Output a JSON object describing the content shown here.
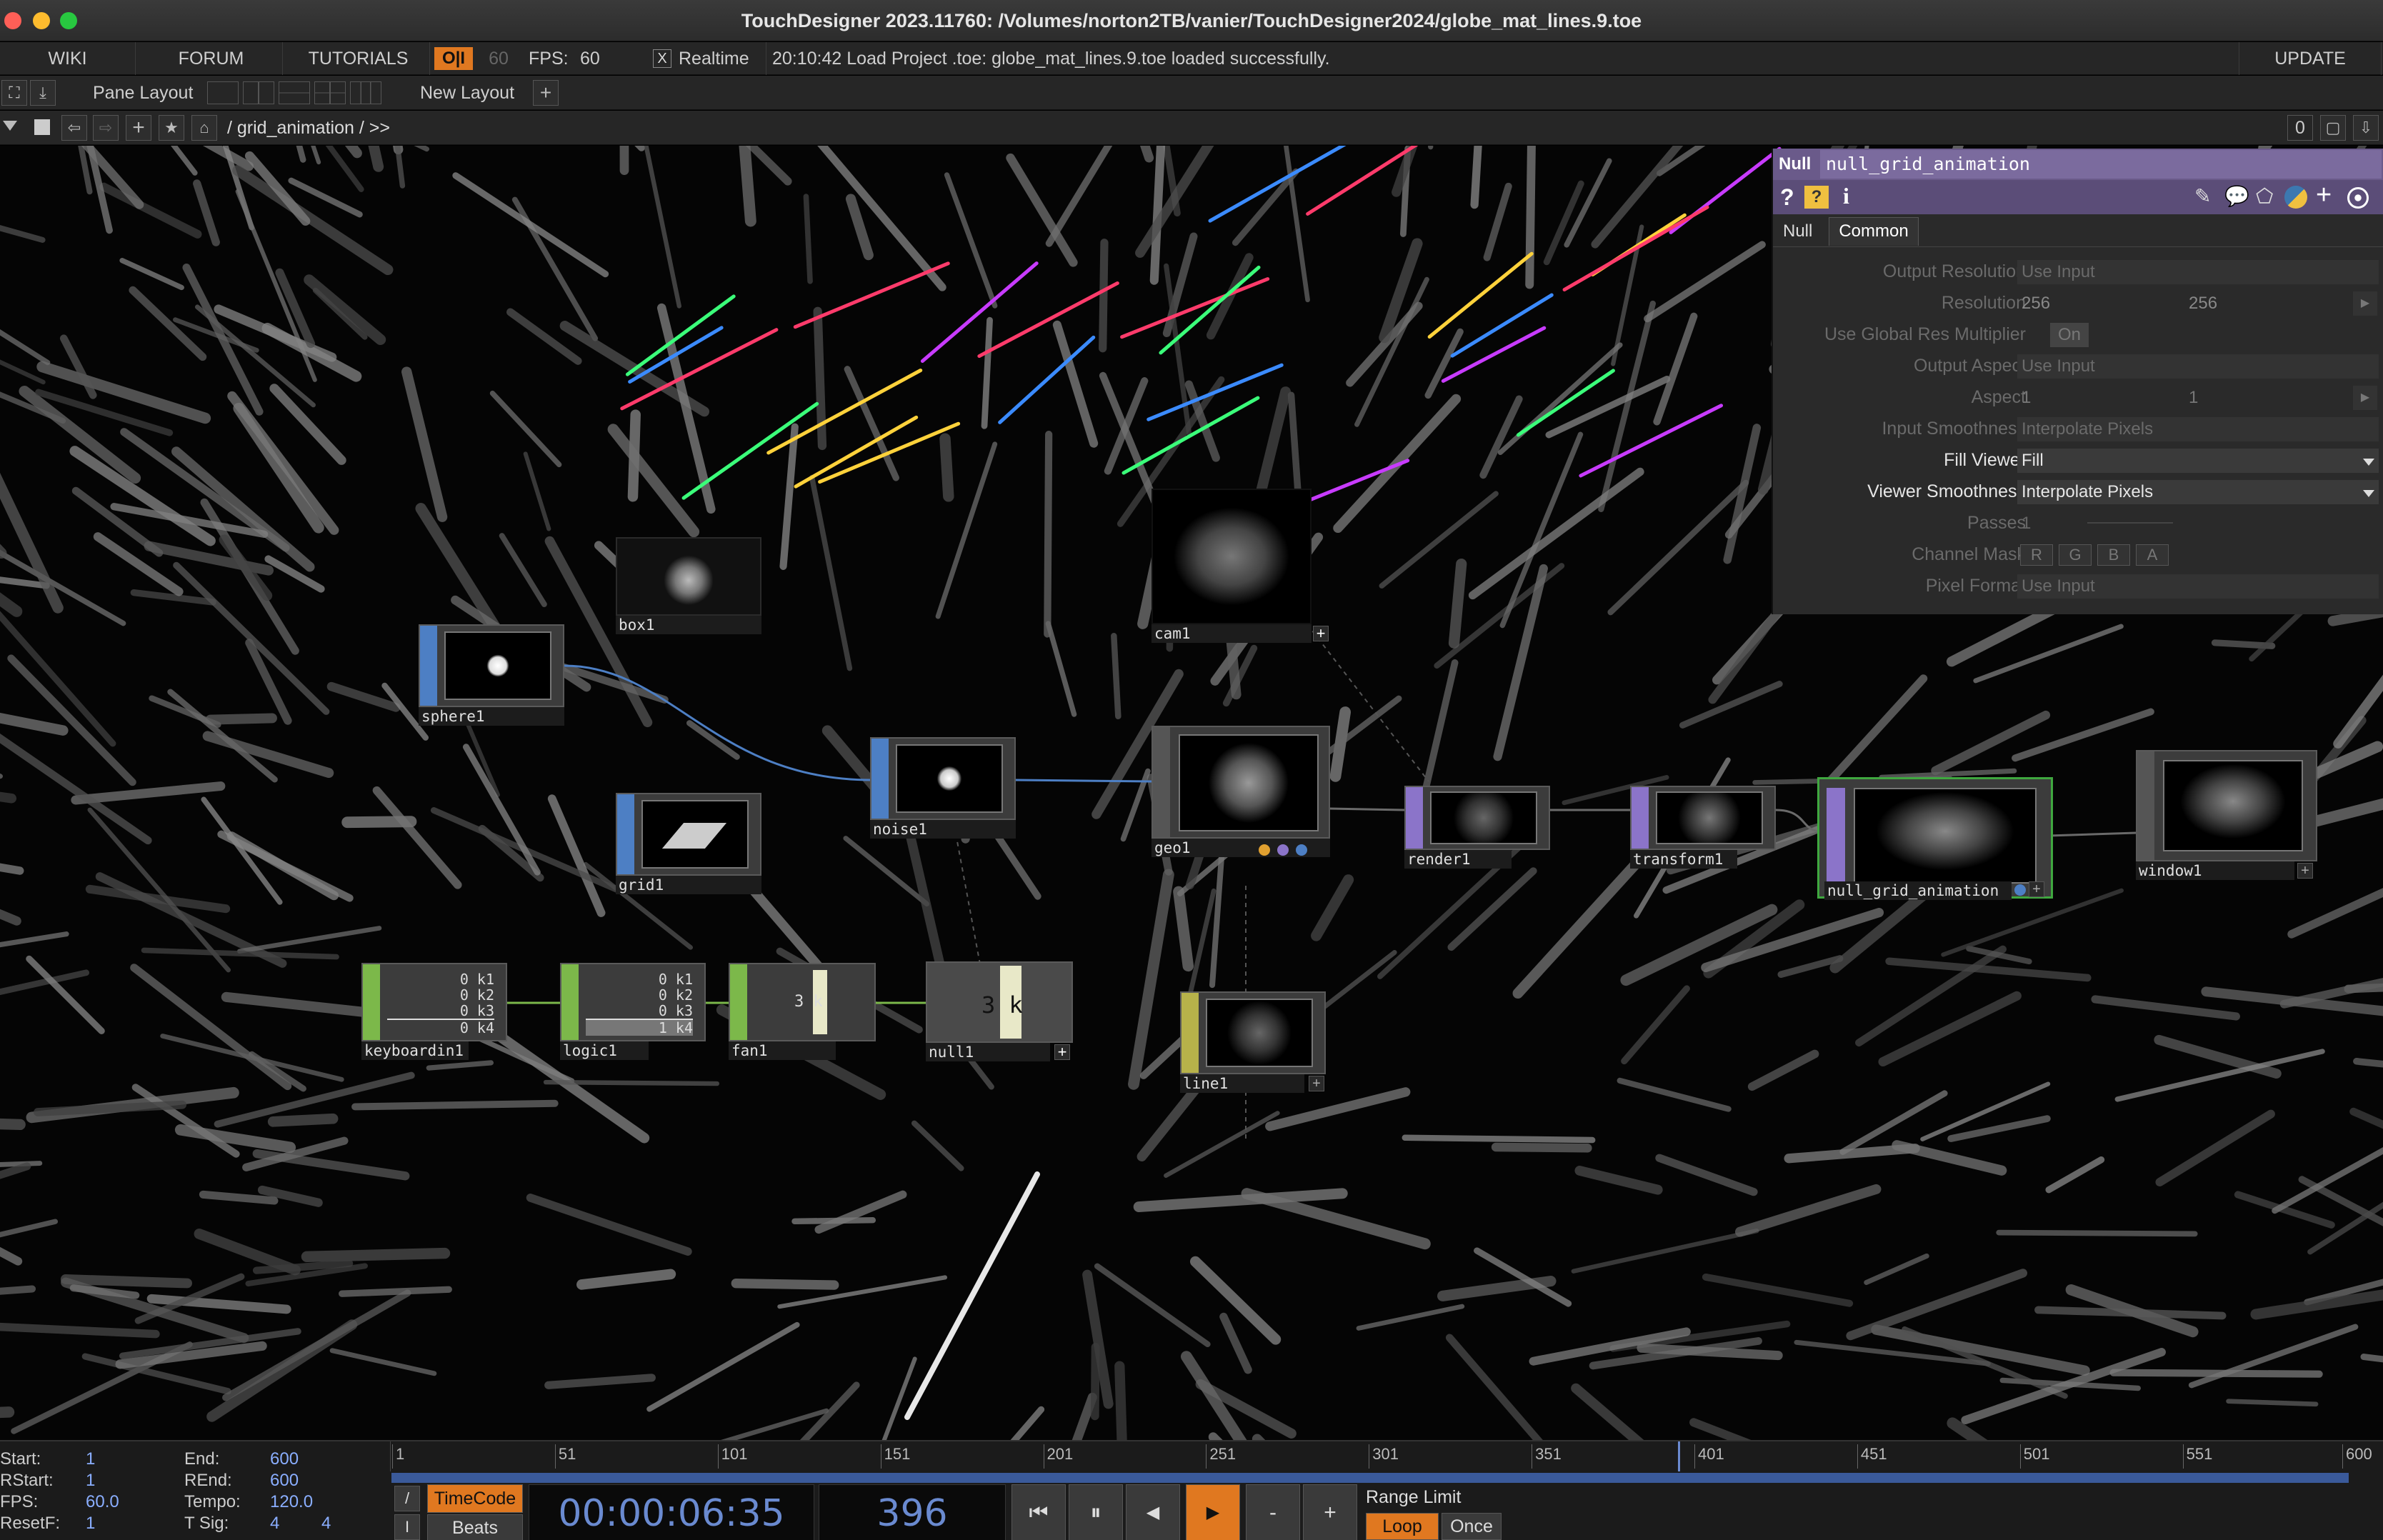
{
  "window": {
    "title": "TouchDesigner 2023.11760: /Volumes/norton2TB/vanier/TouchDesigner2024/globe_mat_lines.9.toe"
  },
  "menubar": {
    "wiki": "WIKI",
    "forum": "FORUM",
    "tutorials": "TUTORIALS",
    "oi": "O|I",
    "fps_cap": "60",
    "fps_label": "FPS:",
    "fps_value": "60",
    "realtime_check": "X",
    "realtime": "Realtime",
    "status": "20:10:42 Load Project .toe: globe_mat_lines.9.toe loaded successfully.",
    "update": "UPDATE"
  },
  "layoutbar": {
    "pane_layout": "Pane Layout",
    "new_layout": "New Layout",
    "plus": "+"
  },
  "pathbar": {
    "path": "/ grid_animation / >>",
    "count": "0"
  },
  "nodes": {
    "box1": "box1",
    "sphere1": "sphere1",
    "grid1": "grid1",
    "noise1": "noise1",
    "cam1": "cam1",
    "geo1": "geo1",
    "render1": "render1",
    "transform1": "transform1",
    "null_grid_animation": "null_grid_animation",
    "window1": "window1",
    "keyboardin1": "keyboardin1",
    "logic1": "logic1",
    "fan1": "fan1",
    "null1": "null1",
    "line1": "line1"
  },
  "chop": {
    "keyboard_rows": [
      "0 k1",
      "0 k2",
      "0 k3",
      "0 k4"
    ],
    "logic_rows": [
      "0 k1",
      "0 k2",
      "0 k3",
      "1 k4"
    ],
    "fan_value": "3 k",
    "null_value": "3 k"
  },
  "panel": {
    "type": "Null",
    "name": "null_grid_animation",
    "tabs": [
      "Null",
      "Common"
    ],
    "params": {
      "output_resolution": {
        "label": "Output Resolution",
        "value": "Use Input"
      },
      "resolution": {
        "label": "Resolution",
        "w": "256",
        "h": "256"
      },
      "global_res": {
        "label": "Use Global Res Multiplier",
        "value": "On"
      },
      "output_aspect": {
        "label": "Output Aspect",
        "value": "Use Input"
      },
      "aspect": {
        "label": "Aspect",
        "a": "1",
        "b": "1"
      },
      "input_smoothness": {
        "label": "Input Smoothness",
        "value": "Interpolate Pixels"
      },
      "fill_viewer": {
        "label": "Fill Viewer",
        "value": "Fill"
      },
      "viewer_smoothness": {
        "label": "Viewer Smoothness",
        "value": "Interpolate Pixels"
      },
      "passes": {
        "label": "Passes",
        "value": "1"
      },
      "channel_mask": {
        "label": "Channel Mask",
        "r": "R",
        "g": "G",
        "b": "B",
        "a": "A"
      },
      "pixel_format": {
        "label": "Pixel Format",
        "value": "Use Input"
      }
    }
  },
  "timeline": {
    "start_label": "Start:",
    "start": "1",
    "end_label": "End:",
    "end": "600",
    "rstart_label": "RStart:",
    "rstart": "1",
    "rend_label": "REnd:",
    "rend": "600",
    "fps_label": "FPS:",
    "fps": "60.0",
    "tempo_label": "Tempo:",
    "tempo": "120.0",
    "resetf_label": "ResetF:",
    "resetf": "1",
    "tsig_label": "T Sig:",
    "tsig_a": "4",
    "tsig_b": "4",
    "ticks": [
      "1",
      "51",
      "101",
      "151",
      "201",
      "251",
      "301",
      "351",
      "401",
      "451",
      "501",
      "551",
      "600"
    ],
    "current_frame": 396,
    "timecode_btn": "TimeCode",
    "beats_btn": "Beats",
    "timecode": "00:00:06:35",
    "frame": "396",
    "range_limit": "Range Limit",
    "loop": "Loop",
    "once": "Once",
    "slash": "/",
    "bar": "I"
  },
  "colors": {
    "top_blue": "#4d7fc4",
    "chop_green": "#7cb84a",
    "sop_yellow": "#b7b24a",
    "tex_purple": "#8b74c9",
    "accent_orange": "#e07820",
    "selected_green": "#3fa83f"
  }
}
